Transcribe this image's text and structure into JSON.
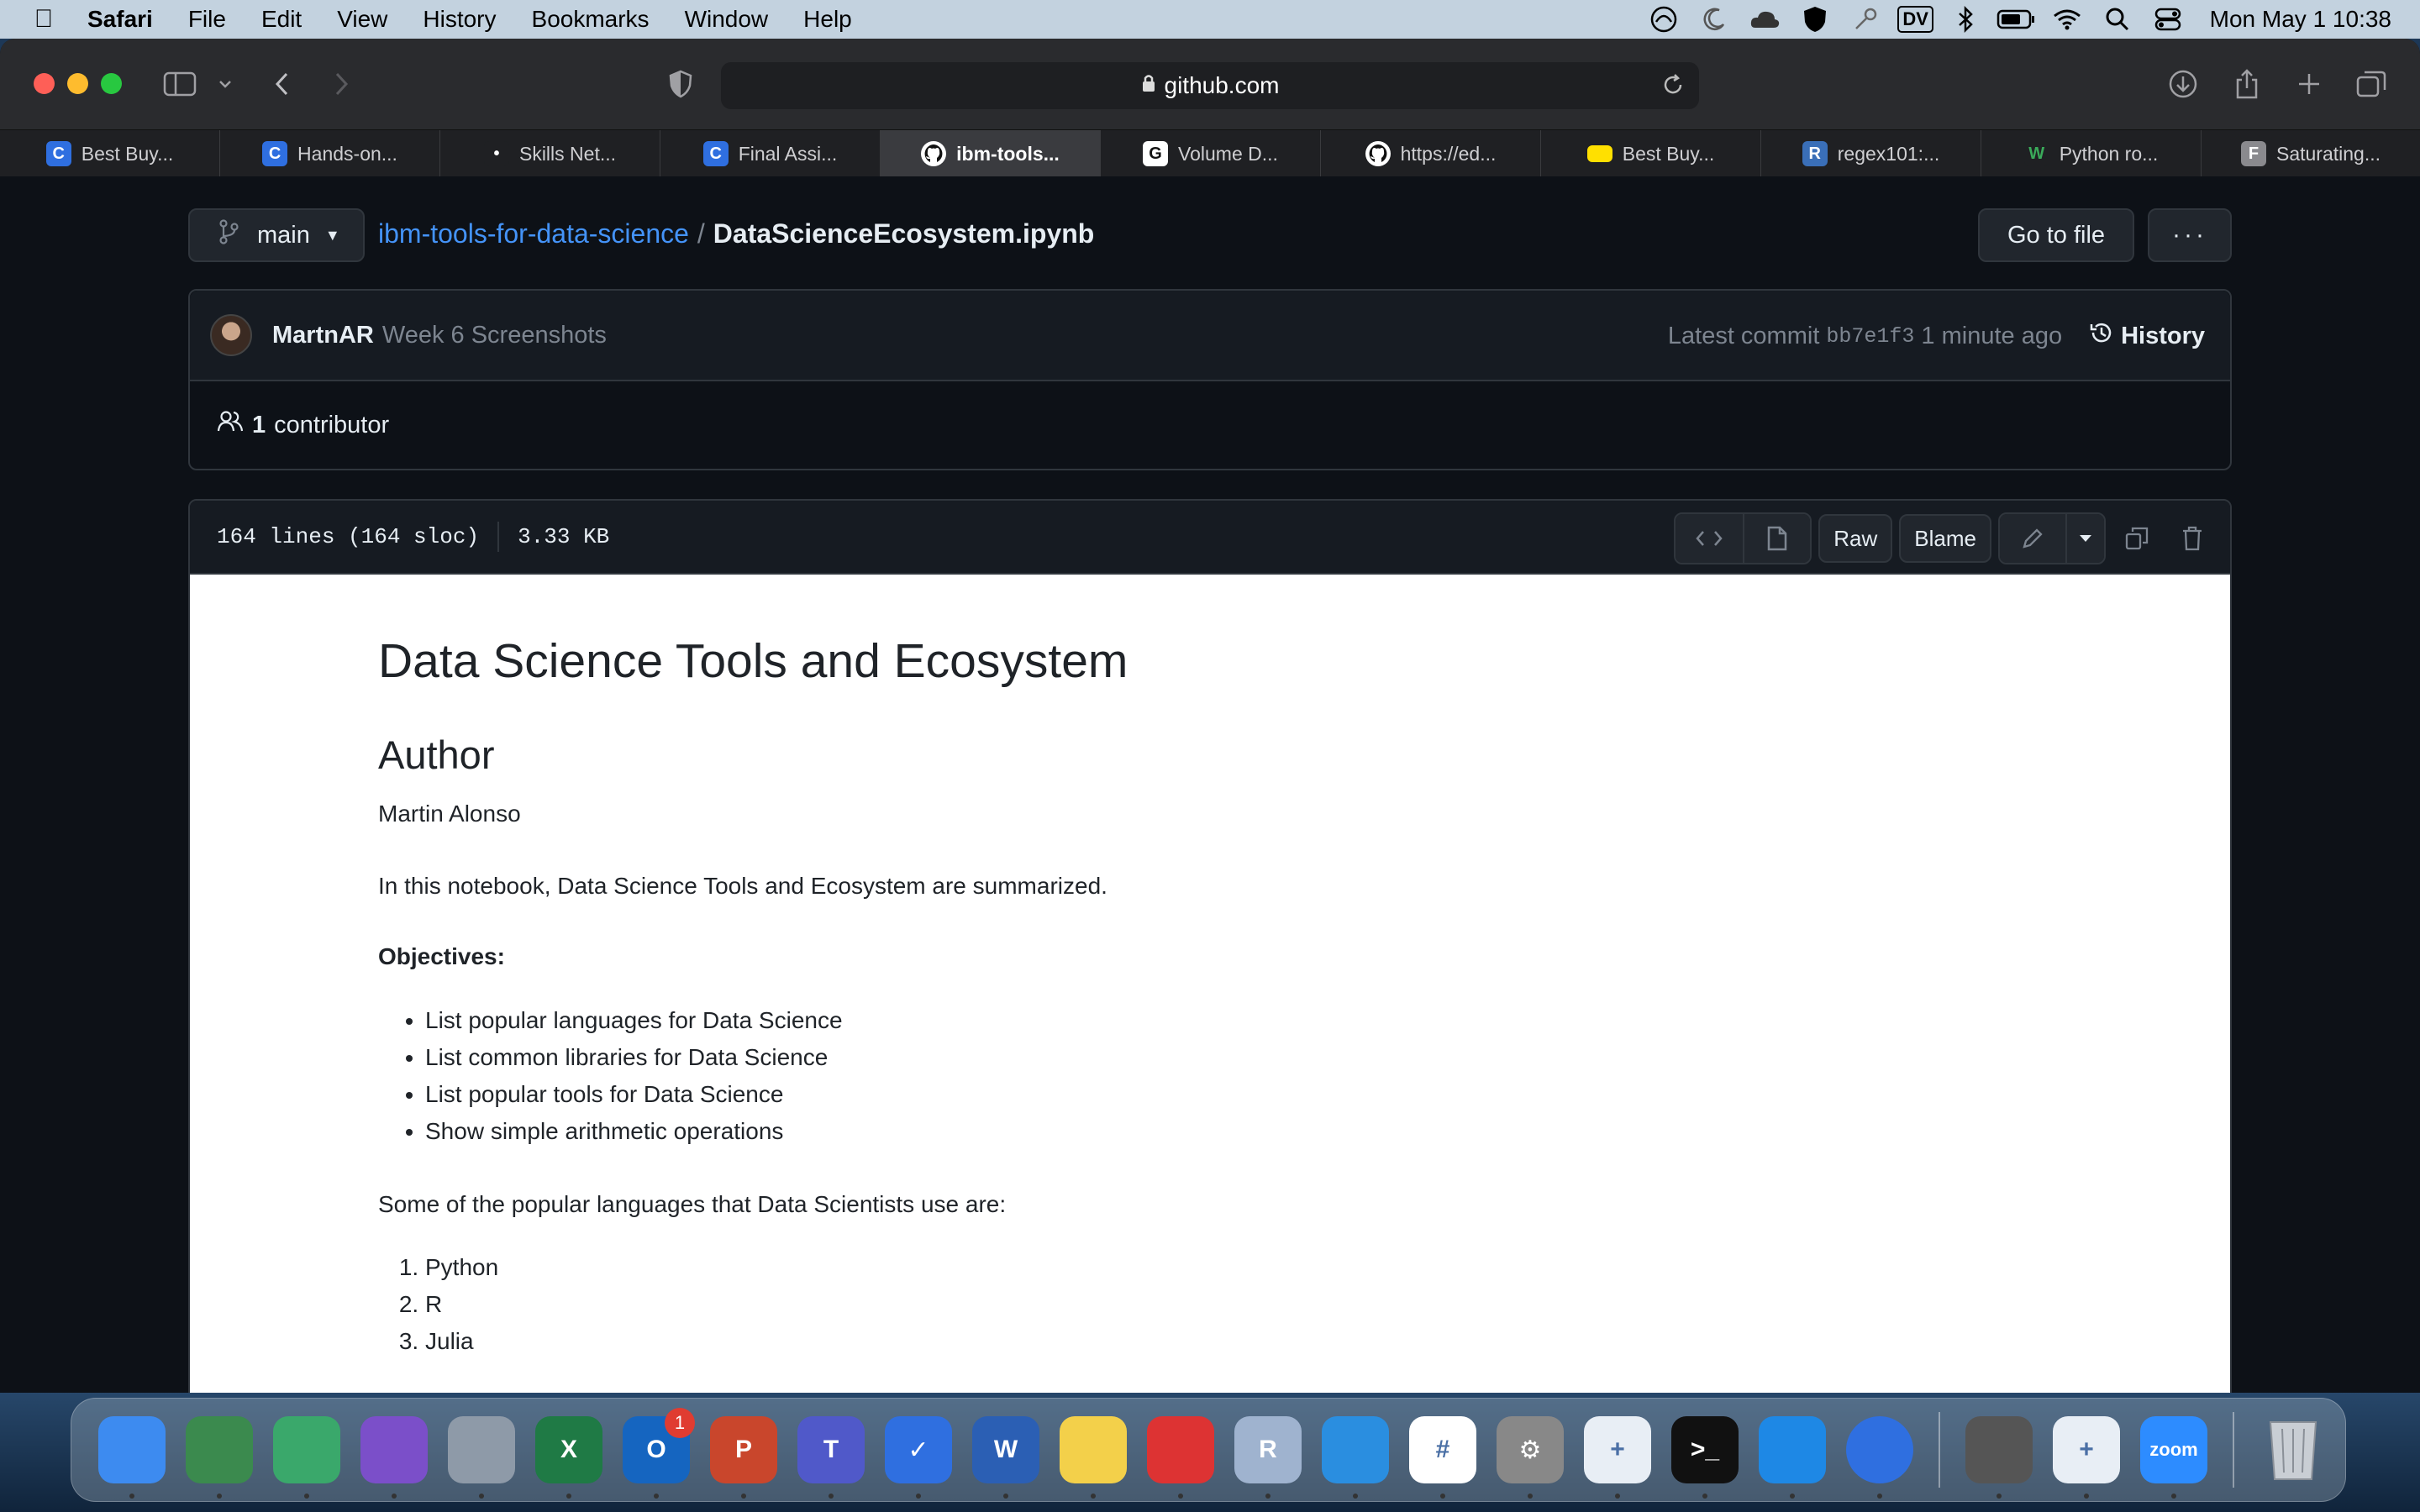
{
  "menubar": {
    "app": "Safari",
    "items": [
      "File",
      "Edit",
      "View",
      "History",
      "Bookmarks",
      "Window",
      "Help"
    ],
    "status_dv": "DV",
    "clock": "Mon May 1  10:38"
  },
  "browser": {
    "url": "github.com",
    "tabs": [
      {
        "label": "Best Buy...",
        "icon": "C",
        "color": "#2f6fe0"
      },
      {
        "label": "Hands-on...",
        "icon": "C",
        "color": "#2f6fe0"
      },
      {
        "label": "Skills Net...",
        "icon": "•",
        "color": "#1f2023"
      },
      {
        "label": "Final Assi...",
        "icon": "C",
        "color": "#2f6fe0"
      },
      {
        "label": "ibm-tools...",
        "icon": "github",
        "color": "#ffffff"
      },
      {
        "label": "Volume D...",
        "icon": "G",
        "color": "#ffffff"
      },
      {
        "label": "https://ed...",
        "icon": "github",
        "color": "#ffffff"
      },
      {
        "label": "Best Buy...",
        "icon": "tag",
        "color": "#ffe000"
      },
      {
        "label": "regex101:...",
        "icon": "R",
        "color": "#3a6fb8"
      },
      {
        "label": "Python ro...",
        "icon": "W",
        "color": "#1f2023"
      },
      {
        "label": "Saturating...",
        "icon": "F",
        "color": "#8a8a8e"
      }
    ]
  },
  "repo": {
    "branch": "main",
    "repo_name": "ibm-tools-for-data-science",
    "separator": "/",
    "file_name": "DataScienceEcosystem.ipynb",
    "go_to_file": "Go to file",
    "more": "···"
  },
  "commit": {
    "author": "MartnAR",
    "message": "Week 6 Screenshots",
    "latest_label": "Latest commit",
    "sha": "bb7e1f3",
    "time": "1 minute ago",
    "history": "History",
    "contributors_count": "1",
    "contributors_label": "contributor"
  },
  "file": {
    "lines": "164 lines (164 sloc)",
    "size": "3.33 KB",
    "raw": "Raw",
    "blame": "Blame"
  },
  "notebook": {
    "title": "Data Science Tools and Ecosystem",
    "author_heading": "Author",
    "author_name": "Martin Alonso",
    "intro": "In this notebook, Data Science Tools and Ecosystem are summarized.",
    "objectives_label": "Objectives:",
    "objectives": [
      "List popular languages for Data Science",
      "List common libraries for Data Science",
      "List popular tools for Data Science",
      "Show simple arithmetic operations"
    ],
    "languages_intro": "Some of the popular languages that Data Scientists use are:",
    "languages": [
      "Python",
      "R",
      "Julia"
    ]
  },
  "dock": {
    "outlook_badge": "1",
    "apps": [
      {
        "name": "finder",
        "label": "",
        "color": "#3d8bf0"
      },
      {
        "name": "network",
        "label": "",
        "color": "#3b8a4e"
      },
      {
        "name": "db-search",
        "label": "",
        "color": "#3aa86b"
      },
      {
        "name": "github-desktop",
        "label": "",
        "color": "#7b4fc9"
      },
      {
        "name": "launchpad",
        "label": "",
        "color": "#8e9aa8"
      },
      {
        "name": "excel",
        "label": "X",
        "color": "#1f7a45"
      },
      {
        "name": "outlook",
        "label": "O",
        "color": "#1565c0"
      },
      {
        "name": "powerpoint",
        "label": "P",
        "color": "#c9462c"
      },
      {
        "name": "teams",
        "label": "T",
        "color": "#5059c9"
      },
      {
        "name": "todo",
        "label": "✓",
        "color": "#2f6fe0"
      },
      {
        "name": "word",
        "label": "W",
        "color": "#2b5fb4"
      },
      {
        "name": "notes",
        "label": "",
        "color": "#f3d04a"
      },
      {
        "name": "parallels",
        "label": "",
        "color": "#d33"
      },
      {
        "name": "r-app",
        "label": "R",
        "color": "#9fb3cf"
      },
      {
        "name": "safari",
        "label": "",
        "color": "#2a8ee0"
      },
      {
        "name": "slack",
        "label": "#",
        "color": "#ffffff"
      },
      {
        "name": "system-prefs",
        "label": "⚙",
        "color": "#888"
      },
      {
        "name": "tableau",
        "label": "+",
        "color": "#e8eef5"
      },
      {
        "name": "terminal",
        "label": ">_",
        "color": "#111"
      },
      {
        "name": "vscode",
        "label": "",
        "color": "#1e88e5"
      },
      {
        "name": "tag-app",
        "label": "",
        "color": "#2f6fe0"
      }
    ],
    "apps_right": [
      {
        "name": "calculator",
        "label": "",
        "color": "#555"
      },
      {
        "name": "tableau-2",
        "label": "+",
        "color": "#e8eef5"
      },
      {
        "name": "zoom",
        "label": "zoom",
        "color": "#2d8cff"
      }
    ]
  }
}
